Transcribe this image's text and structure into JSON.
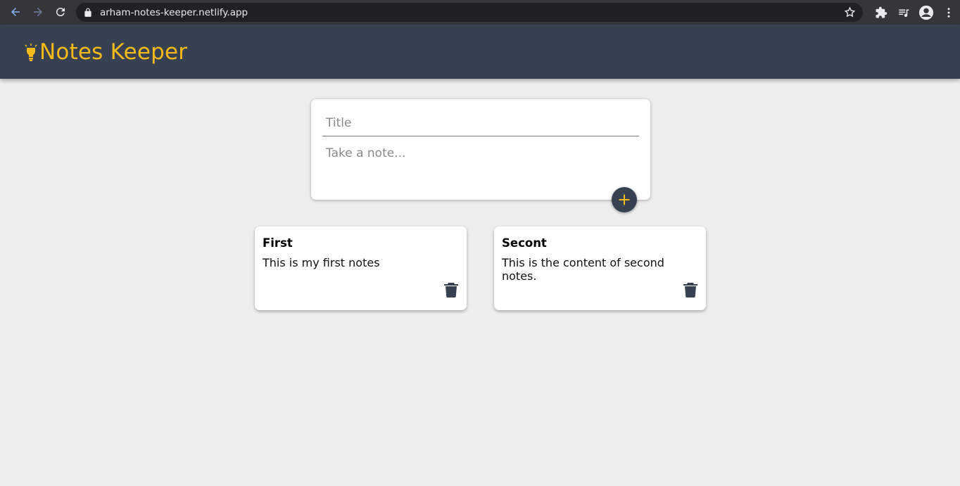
{
  "browser": {
    "url": "arham-notes-keeper.netlify.app",
    "icons": [
      "back-icon",
      "forward-icon",
      "reload-icon",
      "lock-icon",
      "star-icon",
      "extensions-icon",
      "media-icon",
      "profile-icon",
      "menu-icon"
    ]
  },
  "app": {
    "title": "Notes Keeper",
    "logo_icon": "lightbulb-icon",
    "accent_color": "#f5ba13",
    "header_color": "#374151"
  },
  "create_note": {
    "title_placeholder": "Title",
    "content_placeholder": "Take a note...",
    "title_value": "",
    "content_value": "",
    "add_icon": "plus-icon"
  },
  "notes": [
    {
      "title": "First",
      "content": "This is my first notes",
      "delete_icon": "trash-icon"
    },
    {
      "title": "Secont",
      "content": "This is the content of second notes.",
      "delete_icon": "trash-icon"
    }
  ]
}
